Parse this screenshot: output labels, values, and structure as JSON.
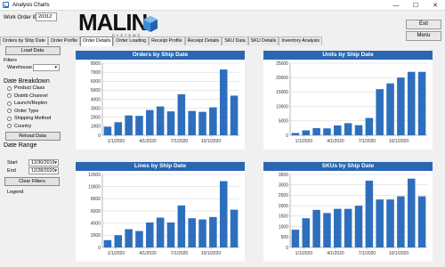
{
  "window": {
    "title": "Analysis Charts",
    "controls": [
      "—",
      "☐",
      "✕"
    ]
  },
  "work_order": {
    "label": "Work Order ID:",
    "value": "20312"
  },
  "logo": {
    "text": "MALIN",
    "sub": "SYSTEMS"
  },
  "buttons": {
    "exit": "Exit",
    "menu": "Menu"
  },
  "tabs": [
    "Orders by Ship Date",
    "Order Profile",
    "Order Details",
    "Order Loading",
    "Receipt Profile",
    "Receipt Details",
    "SKU Data",
    "SKU Details",
    "Inventory Analysis"
  ],
  "active_tab": 2,
  "left": {
    "load": "Load Data",
    "filters": "Filters",
    "warehouse": "Warehouse",
    "breakdown": "Date Breakdown",
    "options": [
      "Product Class",
      "Distrib Channel",
      "Launch/Replen",
      "Order Type",
      "Shipping Method",
      "Country"
    ],
    "reload": "Reload Data",
    "range": "Date Range",
    "start_label": "Start",
    "start": "12/30/2019",
    "end_label": "End",
    "end": "12/28/2020",
    "clear": "Clear Filters",
    "legend": "Legend"
  },
  "colors": {
    "bar": "#2e6fbd",
    "header": "#2b67b1"
  },
  "chart_data": [
    {
      "type": "bar",
      "title": "Orders by Ship Date",
      "categories": [
        "1",
        "2",
        "3",
        "4",
        "5",
        "6",
        "7",
        "8",
        "9",
        "10",
        "11",
        "12",
        "13"
      ],
      "values": [
        950,
        1450,
        2200,
        2150,
        2800,
        3200,
        2650,
        4550,
        2700,
        2600,
        3100,
        7300,
        4400
      ],
      "ylim": [
        0,
        8000
      ],
      "yticks": [
        "0",
        "1000",
        "2000",
        "3000",
        "4000",
        "5000",
        "6000",
        "7000",
        "8000"
      ],
      "xticks": [
        "1/1/2020",
        "4/1/2020",
        "7/1/2020",
        "10/1/2020"
      ]
    },
    {
      "type": "bar",
      "title": "Units by Ship Date",
      "categories": [
        "1",
        "2",
        "3",
        "4",
        "5",
        "6",
        "7",
        "8",
        "9",
        "10",
        "11",
        "12",
        "13"
      ],
      "values": [
        800,
        1700,
        2500,
        2400,
        3400,
        4200,
        3500,
        6000,
        16000,
        18000,
        20000,
        22000,
        22000
      ],
      "ylim": [
        0,
        25000
      ],
      "yticks": [
        "0",
        "5000",
        "10000",
        "15000",
        "20000",
        "25000"
      ],
      "xticks": [
        "1/1/2020",
        "4/1/2020",
        "7/1/2020",
        "10/1/2020"
      ]
    },
    {
      "type": "bar",
      "title": "Lines by Ship Date",
      "categories": [
        "1",
        "2",
        "3",
        "4",
        "5",
        "6",
        "7",
        "8",
        "9",
        "10",
        "11",
        "12",
        "13"
      ],
      "values": [
        1200,
        2000,
        3000,
        2700,
        4100,
        4900,
        4100,
        6900,
        4800,
        4600,
        5000,
        10900,
        6200
      ],
      "ylim": [
        0,
        12000
      ],
      "yticks": [
        "0",
        "2000",
        "4000",
        "6000",
        "8000",
        "10000",
        "12000"
      ],
      "xticks": [
        "1/1/2020",
        "4/1/2020",
        "7/1/2020",
        "10/1/2020"
      ]
    },
    {
      "type": "bar",
      "title": "SKUs by Ship Date",
      "categories": [
        "1",
        "2",
        "3",
        "4",
        "5",
        "6",
        "7",
        "8",
        "9",
        "10",
        "11",
        "12",
        "13"
      ],
      "values": [
        850,
        1400,
        1800,
        1650,
        1850,
        1850,
        2000,
        3200,
        2300,
        2300,
        2450,
        3300,
        2450
      ],
      "ylim": [
        0,
        3500
      ],
      "yticks": [
        "0",
        "500",
        "1000",
        "1500",
        "2000",
        "2500",
        "3000",
        "3500"
      ],
      "xticks": [
        "1/1/2020",
        "4/1/2020",
        "7/1/2020",
        "10/1/2020"
      ]
    }
  ]
}
